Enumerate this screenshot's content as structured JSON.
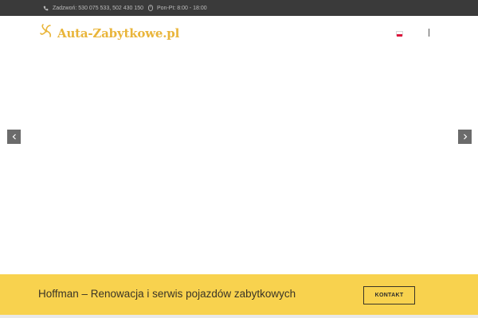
{
  "topbar": {
    "phone_icon": "phone-icon",
    "phone_text": "Zadzwoń: 530 075 533, 502 430 150",
    "hours_icon": "mouse-icon",
    "hours_text": "Pon-Pt: 8:00 - 18:00"
  },
  "header": {
    "logo_icon": "flower-logo-icon",
    "logo_text": "Auta-Zabytkowe.pl",
    "language_flag": "flag-pl-icon",
    "colors": {
      "logo": "#e9b53a",
      "topbar": "#3a3a3a"
    }
  },
  "slider": {
    "prev_icon": "chevron-left-icon",
    "next_icon": "chevron-right-icon"
  },
  "cta": {
    "text": "Hoffman – Renowacja i serwis pojazdów zabytkowych",
    "button_label": "KONTAKT",
    "background": "#f8d24e"
  }
}
